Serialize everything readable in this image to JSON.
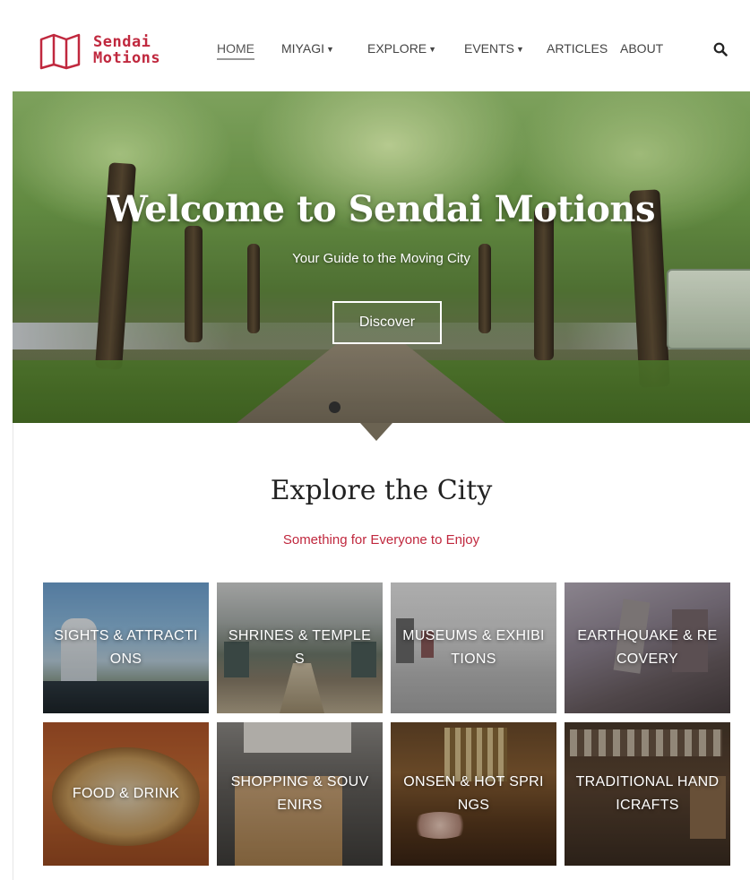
{
  "brand": {
    "line1": "Sendai",
    "line2": "Motions",
    "color": "#c0283e"
  },
  "nav": {
    "items": [
      {
        "label": "HOME",
        "dropdown": false
      },
      {
        "label": "MIYAGI",
        "dropdown": true
      },
      {
        "label": "EXPLORE",
        "dropdown": true
      },
      {
        "label": "EVENTS",
        "dropdown": true
      },
      {
        "label": "ARTICLES",
        "dropdown": false
      },
      {
        "label": "ABOUT",
        "dropdown": false
      }
    ],
    "active": "HOME",
    "search_icon": "search-icon",
    "caret_glyph": "❯"
  },
  "hero": {
    "title": "Welcome to Sendai Motions",
    "subtitle": "Your Guide to the Moving City",
    "button_label": "Discover"
  },
  "section": {
    "title": "Explore the City",
    "subtitle": "Something for Everyone to Enjoy"
  },
  "categories": [
    {
      "label": "SIGHTS & ATTRACTIONS"
    },
    {
      "label": "SHRINES & TEMPLES"
    },
    {
      "label": "MUSEUMS & EXHIBITIONS"
    },
    {
      "label": "EARTHQUAKE & RECOVERY"
    },
    {
      "label": "FOOD & DRINK"
    },
    {
      "label": "SHOPPING & SOUVENIRS"
    },
    {
      "label": "ONSEN & HOT SPRINGS"
    },
    {
      "label": "TRADITIONAL HANDICRAFTS"
    }
  ]
}
